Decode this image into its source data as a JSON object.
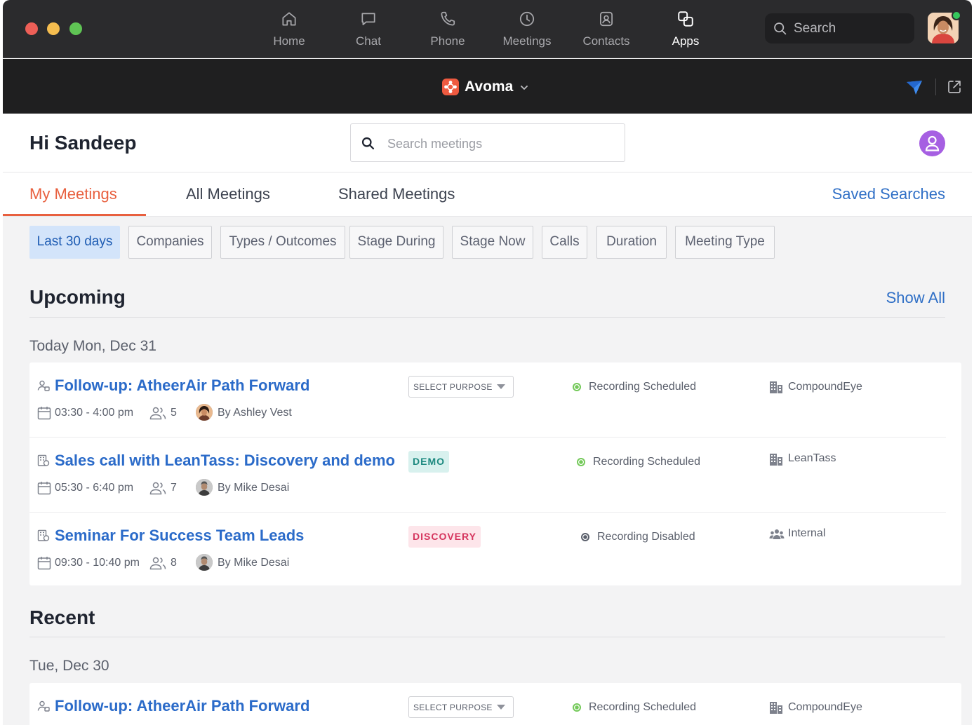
{
  "nav": {
    "items": [
      {
        "label": "Home",
        "icon": "home-icon"
      },
      {
        "label": "Chat",
        "icon": "chat-icon"
      },
      {
        "label": "Phone",
        "icon": "phone-icon"
      },
      {
        "label": "Meetings",
        "icon": "clock-icon"
      },
      {
        "label": "Contacts",
        "icon": "contacts-icon"
      },
      {
        "label": "Apps",
        "icon": "apps-icon"
      }
    ],
    "active": "Apps",
    "search_placeholder": "Search"
  },
  "app": {
    "name": "Avoma",
    "accent": "#ee5a40"
  },
  "header": {
    "greeting": "Hi Sandeep",
    "search_placeholder": "Search meetings"
  },
  "tabs": {
    "items": [
      "My Meetings",
      "All Meetings",
      "Shared Meetings"
    ],
    "active": "My Meetings",
    "saved_searches": "Saved Searches"
  },
  "filters": {
    "items": [
      "Last 30 days",
      "Companies",
      "Types / Outcomes",
      "Stage During",
      "Stage Now",
      "Calls",
      "Duration",
      "Meeting Type"
    ],
    "active": "Last 30 days"
  },
  "upcoming": {
    "title": "Upcoming",
    "show_all": "Show All",
    "day": "Today Mon, Dec 31",
    "meetings": [
      {
        "title": "Follow-up: AtheerAir Path Forward",
        "time": "03:30 - 4:00 pm",
        "attendees": "5",
        "host": "By Ashley Vest",
        "purpose": "SELECT PURPOSE",
        "recording": "Recording Scheduled",
        "company": "CompoundEye"
      },
      {
        "title": "Sales call with LeanTass: Discovery and demo",
        "time": "05:30 - 6:40 pm",
        "attendees": "7",
        "host": "By Mike Desai",
        "purpose": "DEMO",
        "recording": "Recording Scheduled",
        "company": "LeanTass"
      },
      {
        "title": "Seminar For Success Team Leads",
        "time": "09:30 - 10:40 pm",
        "attendees": "8",
        "host": "By Mike Desai",
        "purpose": "DISCOVERY",
        "recording": "Recording Disabled",
        "company": "Internal"
      }
    ]
  },
  "recent": {
    "title": "Recent",
    "day": "Tue, Dec 30",
    "meetings": [
      {
        "title": "Follow-up: AtheerAir Path Forward",
        "purpose": "SELECT PURPOSE",
        "recording": "Recording Scheduled",
        "company": "CompoundEye"
      }
    ]
  }
}
